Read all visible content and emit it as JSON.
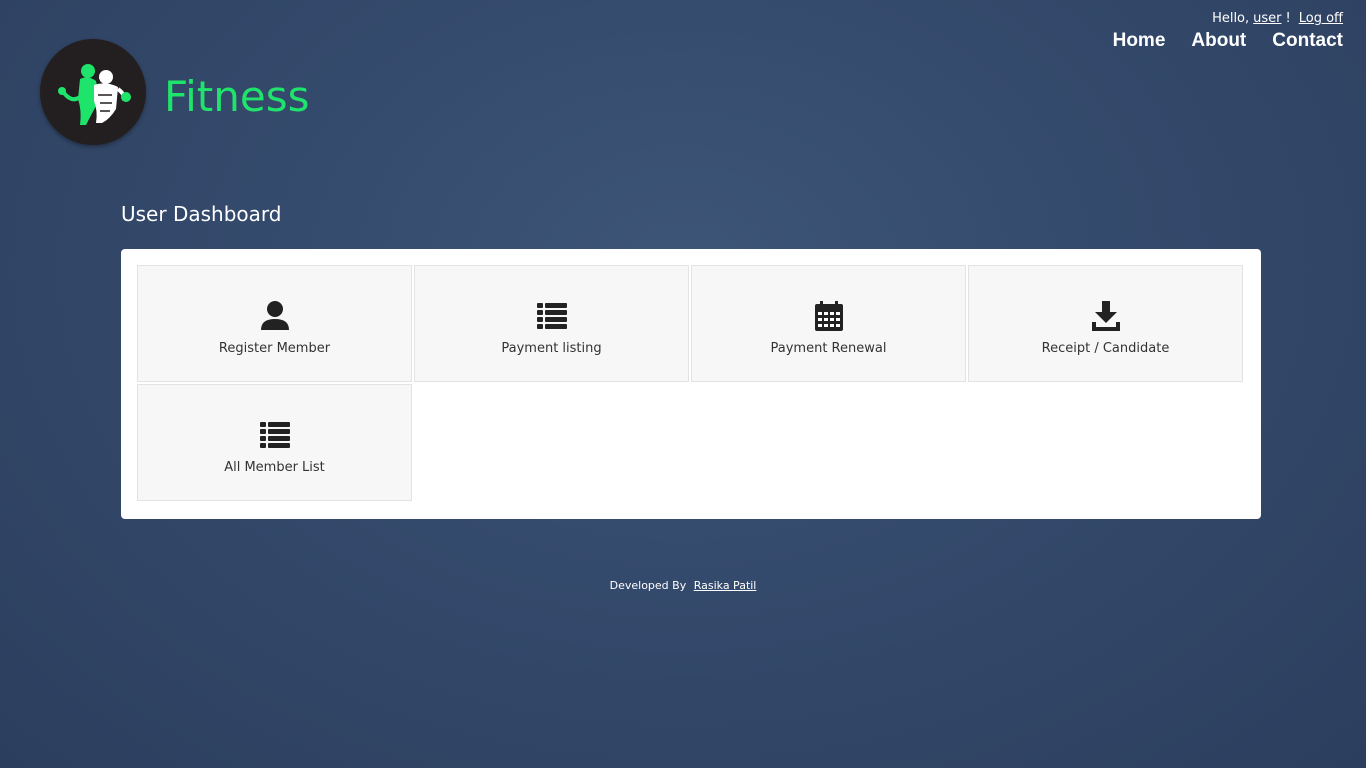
{
  "header": {
    "greeting_prefix": "Hello,",
    "username": "user",
    "greeting_suffix": "!",
    "logoff_label": "Log off",
    "nav": {
      "home": "Home",
      "about": "About",
      "contact": "Contact"
    },
    "logo_text": "Fitness",
    "logo_color": "#1fe46b"
  },
  "main": {
    "title": "User Dashboard",
    "tiles": [
      {
        "label": "Register Member",
        "icon": "user-icon"
      },
      {
        "label": "Payment listing",
        "icon": "list-icon"
      },
      {
        "label": "Payment Renewal",
        "icon": "calendar-icon"
      },
      {
        "label": "Receipt / Candidate",
        "icon": "download-icon"
      },
      {
        "label": "All Member List",
        "icon": "list-icon"
      }
    ]
  },
  "footer": {
    "prefix": "Developed By",
    "author": "Rasika Patil"
  }
}
